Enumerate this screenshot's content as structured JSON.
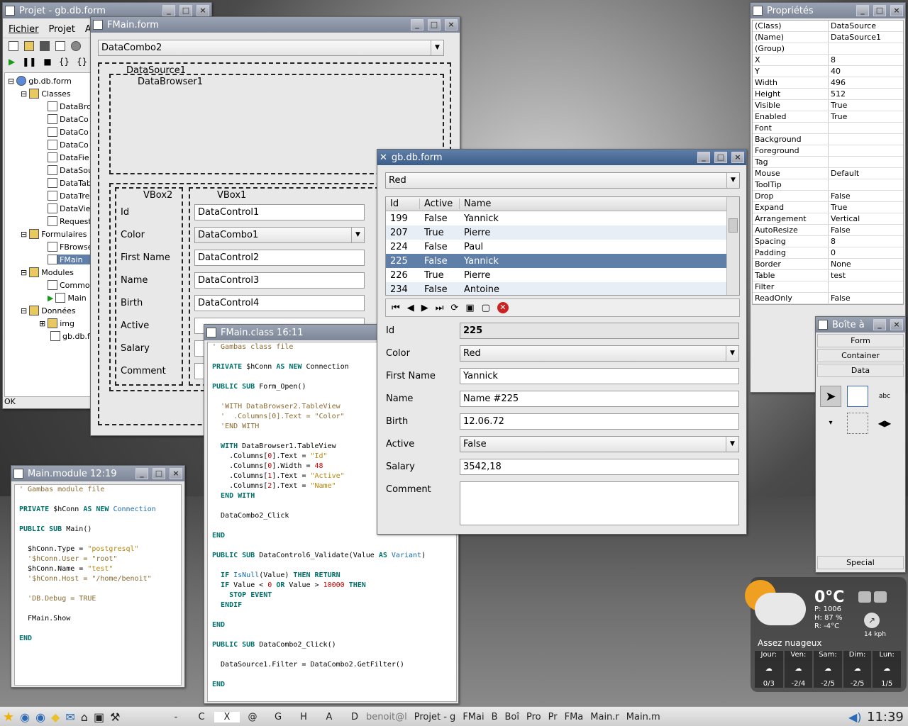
{
  "projet": {
    "title": "Projet - gb.db.form",
    "menu": [
      "Fichier",
      "Projet",
      "A"
    ],
    "status": "OK",
    "tree": [
      "gb.db.form",
      "Classes",
      "DataBro",
      "DataCo",
      "DataCo",
      "DataCo",
      "DataFie",
      "DataSou",
      "DataTab",
      "DataTre",
      "DataVie",
      "Request",
      "Formulaires",
      "FBrowse",
      "FMain",
      "Modules",
      "Commo",
      "Main",
      "Données",
      "img",
      "gb.db.fo"
    ]
  },
  "fmain": {
    "title": "FMain.form",
    "combo": "DataCombo2",
    "datasource": "DataSource1",
    "databrowser": "DataBrowser1",
    "vbox2": "VBox2",
    "vbox1": "VBox1",
    "labels": [
      "Id",
      "Color",
      "First Name",
      "Name",
      "Birth",
      "Active",
      "Salary",
      "Comment"
    ],
    "controls": [
      "DataControl1",
      "DataCombo1",
      "DataControl2",
      "DataControl3",
      "DataControl4"
    ]
  },
  "props": {
    "title": "Propriétés",
    "rows": [
      [
        "(Class)",
        "DataSource"
      ],
      [
        "(Name)",
        "DataSource1"
      ],
      [
        "(Group)",
        ""
      ],
      [
        "X",
        "8"
      ],
      [
        "Y",
        "40"
      ],
      [
        "Width",
        "496"
      ],
      [
        "Height",
        "512"
      ],
      [
        "Visible",
        "True"
      ],
      [
        "Enabled",
        "True"
      ],
      [
        "Font",
        ""
      ],
      [
        "Background",
        ""
      ],
      [
        "Foreground",
        ""
      ],
      [
        "Tag",
        ""
      ],
      [
        "Mouse",
        "Default"
      ],
      [
        "ToolTip",
        ""
      ],
      [
        "Drop",
        "False"
      ],
      [
        "Expand",
        "True"
      ],
      [
        "Arrangement",
        "Vertical"
      ],
      [
        "AutoResize",
        "False"
      ],
      [
        "Spacing",
        "8"
      ],
      [
        "Padding",
        "0"
      ],
      [
        "Border",
        "None"
      ],
      [
        "Table",
        "test"
      ],
      [
        "Filter",
        ""
      ],
      [
        "ReadOnly",
        "False"
      ]
    ]
  },
  "dbform": {
    "title": "gb.db.form",
    "filter": "Red",
    "cols": [
      "Id",
      "Active",
      "Name"
    ],
    "rows": [
      [
        "199",
        "False",
        "Yannick"
      ],
      [
        "207",
        "True",
        "Pierre"
      ],
      [
        "224",
        "False",
        "Paul"
      ],
      [
        "225",
        "False",
        "Yannick"
      ],
      [
        "226",
        "True",
        "Pierre"
      ],
      [
        "234",
        "False",
        "Antoine"
      ]
    ],
    "labels": [
      "Id",
      "Color",
      "First Name",
      "Name",
      "Birth",
      "Active",
      "Salary",
      "Comment"
    ],
    "values": {
      "id": "225",
      "color": "Red",
      "first": "Yannick",
      "name": "Name #225",
      "birth": "12.06.72",
      "active": "False",
      "salary": "3542,18",
      "comment": ""
    }
  },
  "boite": {
    "title": "Boîte à",
    "tabs": [
      "Form",
      "Container",
      "Data"
    ],
    "special": "Special"
  },
  "classwin": {
    "title": "FMain.class 16:11"
  },
  "modwin": {
    "title": "Main.module 12:19"
  },
  "weather": {
    "temp": "0°C",
    "p": "P: 1006",
    "h": "H: 87 %",
    "r": "R: -4°C",
    "wind": "14 kph",
    "desc": "Assez nuageux",
    "days": [
      "Jour:",
      "Ven:",
      "Sam:",
      "Dim:",
      "Lun:"
    ],
    "temps": [
      "0/3",
      "-2/4",
      "-2/5",
      "-2/5",
      "1/5"
    ]
  },
  "taskbar": {
    "clock": "11:39",
    "letters": [
      "-",
      "C",
      "X",
      "@",
      "G",
      "H",
      "A",
      "D"
    ],
    "tasks": [
      "benoit@l",
      "Projet - g",
      "FMai",
      "B",
      "Boî",
      "Pro",
      "Pr",
      "FMa",
      "Main.r",
      "Main.m"
    ]
  }
}
